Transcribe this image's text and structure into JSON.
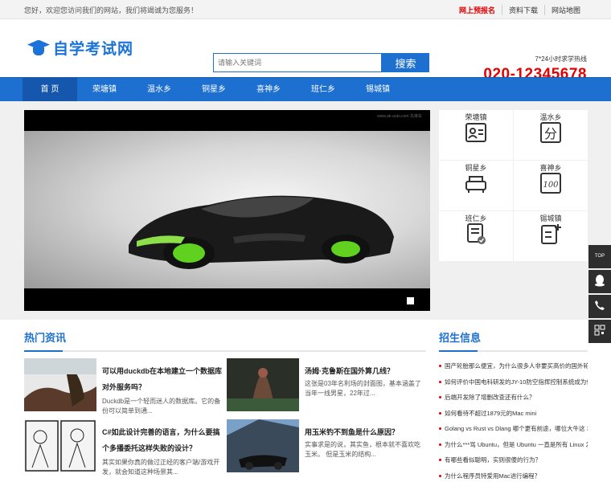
{
  "topbar": {
    "welcome": "您好，欢迎您访问我们的网站，我们将竭诚为您服务！",
    "links": [
      "网上预报名",
      "资料下载",
      "网站地图"
    ]
  },
  "header": {
    "logo_text": "自学考试网",
    "search_placeholder": "请输入关键词",
    "search_button": "搜索",
    "hotline_label": "7*24小时求学热线",
    "hotline_number": "020-12345678"
  },
  "nav": [
    "首 页",
    "荣塘镇",
    "温水乡",
    "铜星乡",
    "喜神乡",
    "班仁乡",
    "锡城镇"
  ],
  "tiles": [
    "荣塘镇",
    "温水乡",
    "铜星乡",
    "喜神乡",
    "班仁乡",
    "锡城镇"
  ],
  "hot_news": {
    "title": "热门资讯",
    "items": [
      {
        "headline": "可以用duckdb在本地建立一个数据库对外服务吗？",
        "desc": "Duckdb是一个轻而迷人的数据库。它的备份可以简单到通..."
      },
      {
        "headline": "汤姆·克鲁斯在国外算几线？",
        "desc": "这张是03年名利场的封面图，基本涵盖了当年一线男星，22年过..."
      },
      {
        "headline": "C#如此设计完善的语言，为什么要搞个多播委托这样失败的设计？",
        "desc": "其实如果你真的做过正经的客户端/游戏开发，就会知道这种场景其..."
      },
      {
        "headline": "用玉米钓不到鱼是什么原因？",
        "desc": "实事求是的说，其实鱼，根本就不喜欢吃玉米。 但是玉米的结构..."
      }
    ]
  },
  "recruit": {
    "title": "招生信息",
    "items": [
      "国产轮胎那么便宜，为什么很多人非要买高价的国外轮",
      "如何评价中国电科研发的JY-10防空指挥控制系统成为伊",
      "后端开发除了增删改查还有什么？",
      "如何看待不超过1879元的Mac mini",
      "Golang vs Rust vs Dlang 哪个更有前途，哪位大牛这 3",
      "为什么***骂 Ubuntu，但是 Ubuntu 一直是所有 Linux 发",
      "有哪些看似聪明，实则很傻的行为？",
      "为什么程序员特爱用Mac进行编程？"
    ]
  },
  "sidebar": {
    "top_label": "TOP"
  },
  "slider_caption": "www.ak-auto.com 先锋车"
}
